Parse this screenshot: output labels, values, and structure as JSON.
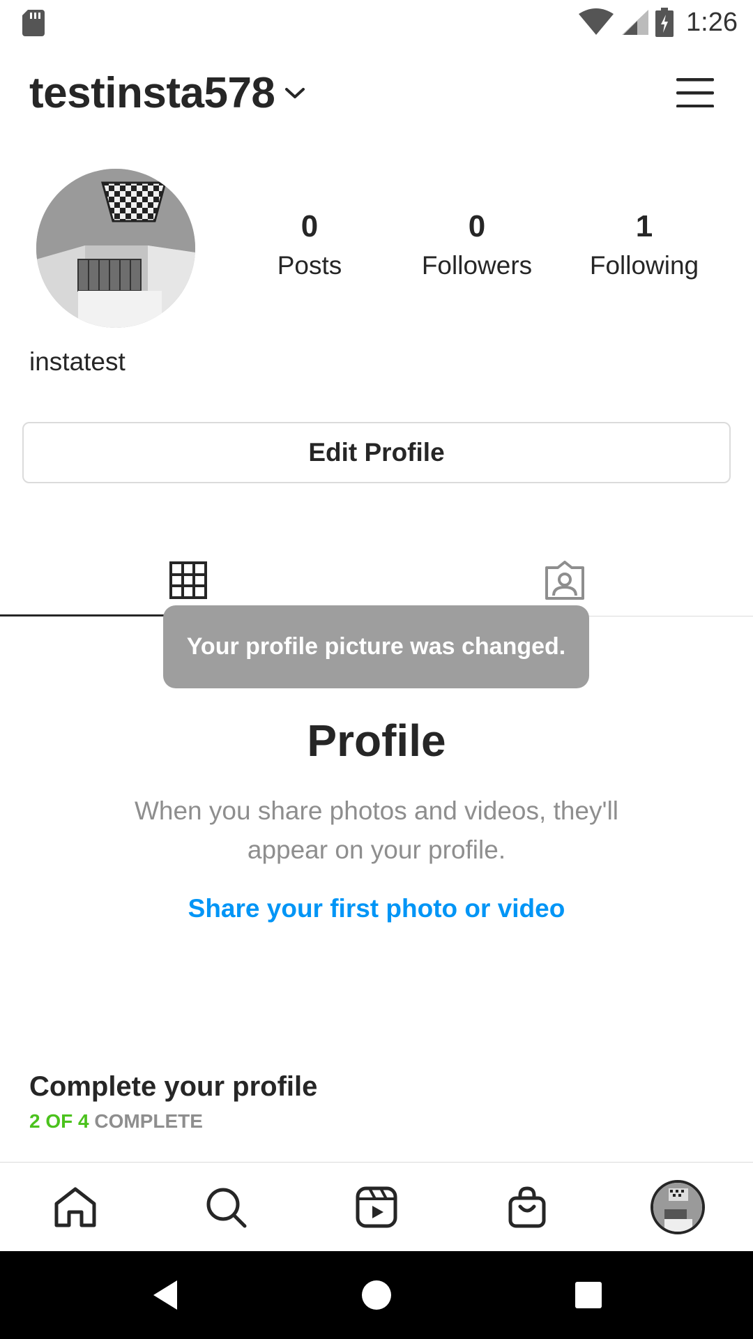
{
  "status_bar": {
    "time": "1:26"
  },
  "header": {
    "username": "testinsta578"
  },
  "profile": {
    "display_name": "instatest",
    "stats": [
      {
        "value": "0",
        "label": "Posts"
      },
      {
        "value": "0",
        "label": "Followers"
      },
      {
        "value": "1",
        "label": "Following"
      }
    ],
    "edit_button_label": "Edit Profile"
  },
  "tabs": {
    "active": "grid",
    "items": [
      "grid-icon",
      "tagged-icon"
    ]
  },
  "toast": {
    "message": "Your profile picture was changed."
  },
  "empty_state": {
    "title": "Profile",
    "description": "When you share photos and videos, they'll appear on your profile.",
    "link_label": "Share your first photo or video"
  },
  "complete_profile": {
    "title": "Complete your profile",
    "progress_done": "2 OF 4",
    "progress_rest": "COMPLETE",
    "progress_fraction": 0.5
  },
  "bottom_nav": {
    "items": [
      "home-icon",
      "search-icon",
      "reels-icon",
      "shop-icon",
      "profile-avatar"
    ],
    "active": "profile-avatar"
  },
  "colors": {
    "link": "#0095f6",
    "progress_green": "#4bc21d",
    "toast_bg": "#9e9e9e",
    "text": "#262626",
    "muted": "#8e8e8e"
  }
}
